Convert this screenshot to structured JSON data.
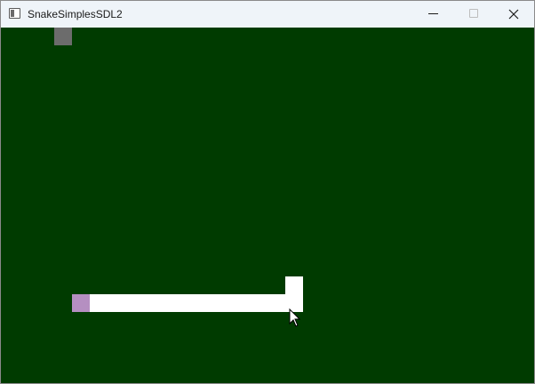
{
  "window": {
    "title": "SnakeSimplesSDL2",
    "icon": "window-app-icon"
  },
  "controls": {
    "minimize_icon": "minimize-icon",
    "maximize_icon": "maximize-icon",
    "close_icon": "close-icon"
  },
  "game": {
    "board_color": "#003b00",
    "food": {
      "color": "#6c6c6c"
    },
    "snake": {
      "head_color": "#b58fc1",
      "body_color": "#ffffff"
    }
  },
  "cursor": {
    "icon": "mouse-pointer-icon"
  }
}
